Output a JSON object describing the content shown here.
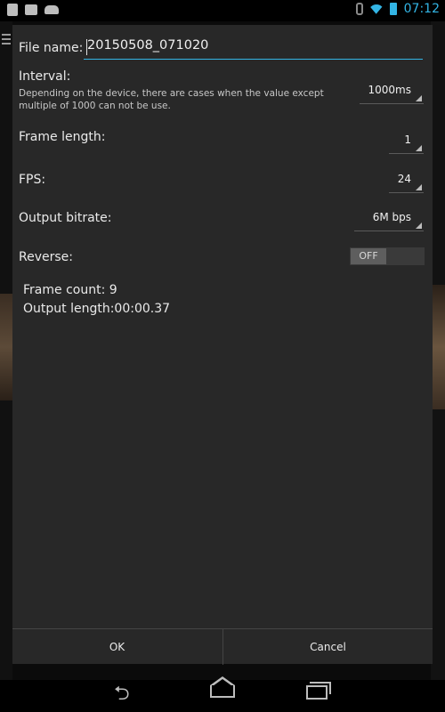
{
  "status_bar": {
    "time": "07:12",
    "left_icons": [
      "phone-notification-icon",
      "briefcase-notification-icon",
      "android-notification-icon"
    ],
    "right_icons": [
      "bluetooth-icon",
      "wifi-icon",
      "battery-icon"
    ]
  },
  "dialog": {
    "file_name": {
      "label": "File name:",
      "value": "20150508_071020"
    },
    "interval": {
      "label": "Interval:",
      "hint": "Depending on the device, there are cases when the value except multiple of 1000 can not be use.",
      "value": "1000ms"
    },
    "frame_length": {
      "label": "Frame length:",
      "value": "1"
    },
    "fps": {
      "label": "FPS:",
      "value": "24"
    },
    "output_bitrate": {
      "label": "Output bitrate:",
      "value": "6M bps"
    },
    "reverse": {
      "label": "Reverse:",
      "toggle": "OFF"
    },
    "frame_count": "Frame count: 9",
    "output_length": "Output length:00:00.37",
    "buttons": {
      "ok": "OK",
      "cancel": "Cancel"
    }
  },
  "colors": {
    "accent": "#33b5e5",
    "dialog_bg": "#282828"
  },
  "nav_bar": {
    "icons": [
      "back-icon",
      "home-icon",
      "recents-icon"
    ]
  }
}
